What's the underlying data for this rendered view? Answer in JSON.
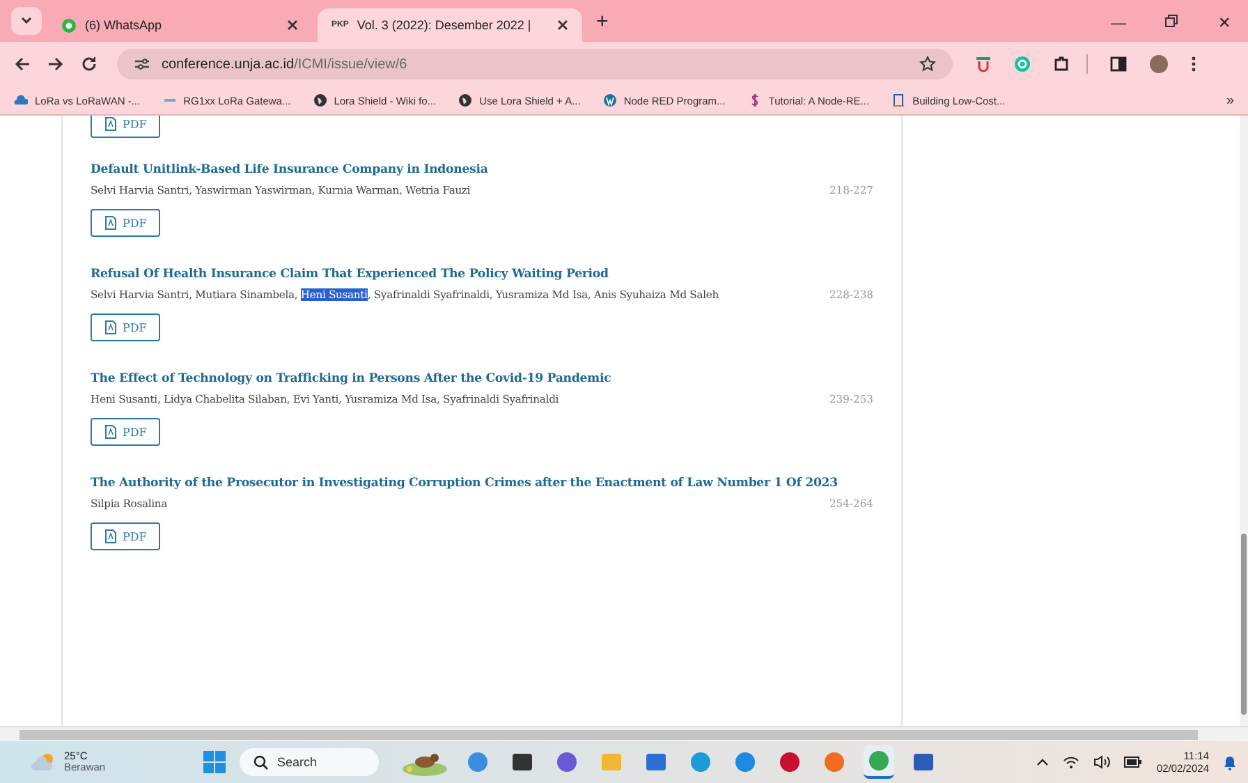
{
  "tabs": [
    {
      "label": "(6) WhatsApp",
      "selected": false,
      "kind": "dot"
    },
    {
      "label": "Vol. 3 (2022): Desember 2022 |",
      "selected": true,
      "kind": "text",
      "favicon_text": "PKP"
    }
  ],
  "new_tab": "+",
  "window_controls": {
    "minimize": "—",
    "close": "✕"
  },
  "address": {
    "host": "conference.unja.ac.id",
    "path": "/ICMI/issue/view/6"
  },
  "bookmarks": [
    {
      "label": "LoRa vs LoRaWAN -...",
      "kind": "cloud"
    },
    {
      "label": "RG1xx LoRa Gatewa...",
      "kind": "dash"
    },
    {
      "label": "Lora Shield - Wiki fo...",
      "kind": "globe"
    },
    {
      "label": "Use Lora Shield + A...",
      "kind": "globe"
    },
    {
      "label": "Node RED Program...",
      "kind": "wp"
    },
    {
      "label": "Tutorial: A Node-RE...",
      "kind": "squiggle"
    },
    {
      "label": "Building Low-Cost...",
      "kind": "doc"
    }
  ],
  "bookmarks_more": "»",
  "top_pdf_button": "PDF",
  "articles": [
    {
      "title": "Default Unitlink-Based Life Insurance Company in Indonesia",
      "authors": [
        {
          "text": "Selvi Harvia Santri, Yaswirman Yaswirman, Kurnia Warman, Wetria Fauzi",
          "selected": false
        }
      ],
      "pages": "218-227",
      "pdf": "PDF"
    },
    {
      "title": "Refusal Of Health Insurance Claim That Experienced The Policy Waiting Period",
      "authors": [
        {
          "text": "Selvi Harvia Santri, Mutiara Sinambela, ",
          "selected": false
        },
        {
          "text": "Heni Susanti",
          "selected": true
        },
        {
          "text": ", Syafrinaldi Syafrinaldi, Yusramiza Md Isa, Anis Syuhaiza Md Saleh",
          "selected": false
        }
      ],
      "pages": "228-238",
      "pdf": "PDF"
    },
    {
      "title": "The Effect of Technology on Trafficking in Persons After the Covid-19 Pandemic",
      "authors": [
        {
          "text": "Heni Susanti, Lidya Chabelita Silaban, Evi Yanti, Yusramiza Md Isa, Syafrinaldi Syafrinaldi",
          "selected": false
        }
      ],
      "pages": "239-253",
      "pdf": "PDF"
    },
    {
      "title": "The Authority of the Prosecutor in Investigating Corruption Crimes after the Enactment of Law Number 1 Of 2023",
      "authors": [
        {
          "text": "Silpia Rosalina",
          "selected": false
        }
      ],
      "pages": "254-264",
      "pdf": "PDF"
    }
  ],
  "taskbar": {
    "weather": {
      "temp": "25°C",
      "condition": "Berawan"
    },
    "search": "Search",
    "apps": [
      {
        "kind": "picture"
      },
      {
        "kind": "copilot",
        "selected": false
      },
      {
        "kind": "taskview",
        "selected": false
      },
      {
        "kind": "meet",
        "selected": false
      },
      {
        "kind": "folder",
        "selected": false
      },
      {
        "kind": "store",
        "selected": false
      },
      {
        "kind": "edge",
        "selected": false
      },
      {
        "kind": "help",
        "selected": false
      },
      {
        "kind": "mcafee",
        "selected": false
      },
      {
        "kind": "firefox",
        "selected": false
      },
      {
        "kind": "chrome",
        "selected": true
      },
      {
        "kind": "word",
        "selected": false
      }
    ],
    "time": "11:14",
    "date": "02/02/2024"
  }
}
